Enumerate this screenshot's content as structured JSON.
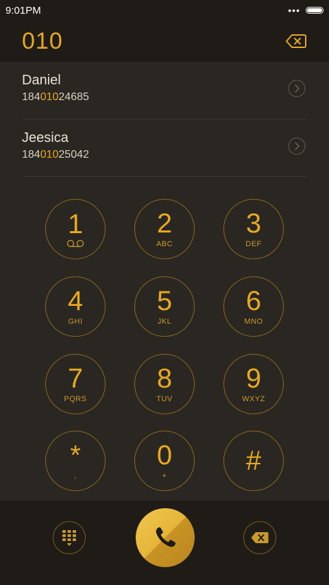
{
  "status_bar": {
    "time": "9:01PM",
    "dots": "•••"
  },
  "dialer": {
    "entered_number": "010"
  },
  "contacts": [
    {
      "name": "Daniel",
      "number_prefix": "184",
      "number_match": "010",
      "number_suffix": "24685"
    },
    {
      "name": "Jeesica",
      "number_prefix": "184",
      "number_match": "010",
      "number_suffix": "25042"
    }
  ],
  "keypad": [
    {
      "digit": "1",
      "letters": ""
    },
    {
      "digit": "2",
      "letters": "ABC"
    },
    {
      "digit": "3",
      "letters": "DEF"
    },
    {
      "digit": "4",
      "letters": "GHI"
    },
    {
      "digit": "5",
      "letters": "JKL"
    },
    {
      "digit": "6",
      "letters": "MNO"
    },
    {
      "digit": "7",
      "letters": "PQRS"
    },
    {
      "digit": "8",
      "letters": "TUV"
    },
    {
      "digit": "9",
      "letters": "WXYZ"
    },
    {
      "digit": "*",
      "letters": ","
    },
    {
      "digit": "0",
      "letters": "+"
    },
    {
      "digit": "#",
      "letters": ""
    }
  ],
  "colors": {
    "accent": "#e6a920",
    "background": "#2a2621",
    "bar": "#1f1c18"
  },
  "icons": {
    "voicemail": "voicemail-icon",
    "backspace": "backspace-icon",
    "chevron": "chevron-right-icon",
    "keypad_toggle": "keypad-icon",
    "call": "phone-icon"
  }
}
